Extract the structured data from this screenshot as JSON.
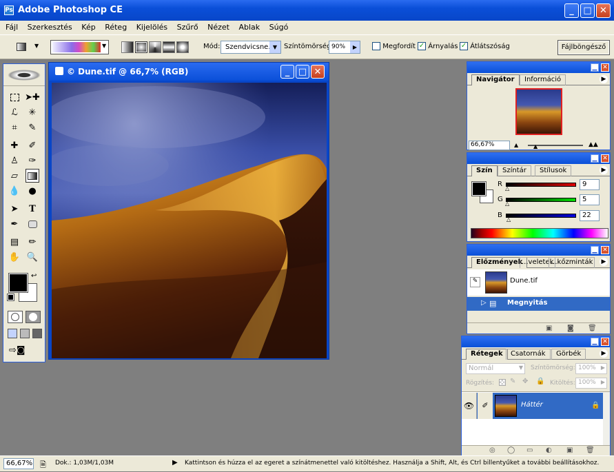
{
  "app": {
    "title": "Adobe Photoshop CE"
  },
  "menu": [
    "Fájl",
    "Szerkesztés",
    "Kép",
    "Réteg",
    "Kijelölés",
    "Szűrő",
    "Nézet",
    "Ablak",
    "Súgó"
  ],
  "options": {
    "mode_label": "Mód:",
    "mode_value": "Szendvicsne...",
    "opacity_label": "Színtömörség:",
    "opacity_value": "90%",
    "reverse_label": "Megfordít",
    "dither_label": "Árnyalás",
    "transparency_label": "Átlátszóság",
    "browser_label": "Fájlböngésző",
    "reverse_checked": false,
    "dither_checked": true,
    "transparency_checked": true
  },
  "document": {
    "title": "© Dune.tif @ 66,7% (RGB)"
  },
  "navigator": {
    "tabs": [
      "Navigátor",
      "Információ"
    ],
    "zoom": "66,67%"
  },
  "color": {
    "tabs": [
      "Szín",
      "Színtár",
      "Stílusok"
    ],
    "r_label": "R",
    "g_label": "G",
    "b_label": "B",
    "r": "9",
    "g": "5",
    "b": "22"
  },
  "history": {
    "tabs": [
      "Előzmények",
      "...veletek",
      "...kőzminták"
    ],
    "snapshot": "Dune.tif",
    "step": "Megnyitás"
  },
  "layers": {
    "tabs": [
      "Rétegek",
      "Csatornák",
      "Görbék"
    ],
    "mode": "Normál",
    "opacity_label": "Színtömörség:",
    "opacity_value": "100%",
    "lock_label": "Rögzítés:",
    "fill_label": "Kitöltés:",
    "fill_value": "100%",
    "layer_name": "Háttér"
  },
  "status": {
    "zoom": "66,67%",
    "doc": "Dok.: 1,03M/1,03M",
    "hint": "Kattintson és húzza el az egeret a színátmenettel való kitöltéshez. Használja a Shift, Alt, és Ctrl billentyűket a további beállításokhoz."
  },
  "colors": {
    "accent": "#0a50d8",
    "selection": "#316ac5",
    "workspace": "#7f7f7f"
  }
}
